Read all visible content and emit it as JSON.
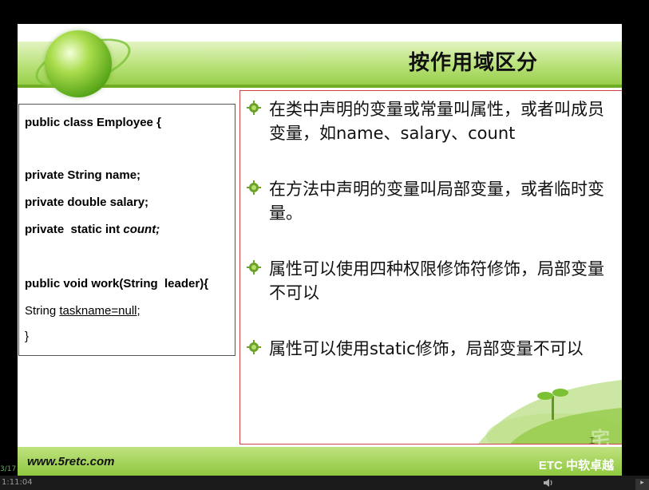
{
  "slide": {
    "title": "按作用域区分",
    "code": {
      "lines": [
        "public class Employee {",
        "private String name;",
        "private double salary;",
        "private  static int ",
        "count;",
        "public void work(String  leader){",
        "String ",
        "taskname=null;",
        "}"
      ]
    },
    "bullets": [
      "在类中声明的变量或常量叫属性，或者叫成员变量，如name、salary、count",
      "在方法中声明的变量叫局部变量，或者临时变量。",
      "属性可以使用四种权限修饰符修饰，局部变量不可以",
      "属性可以使用static修饰，局部变量不可以"
    ],
    "footer": {
      "site": "www.5retc.com",
      "brand": "ETC 中软卓越"
    }
  },
  "player": {
    "time": "1:11:04",
    "progress_label": "3/17",
    "watermark": "宅"
  },
  "colors": {
    "accent_green": "#8fc73f",
    "border_red": "#c44",
    "bullet_green": "#6aa22a"
  },
  "icons": {
    "bullet": "gear-bullet-icon",
    "logo": "globe-logo-icon",
    "volume": "volume-icon"
  }
}
